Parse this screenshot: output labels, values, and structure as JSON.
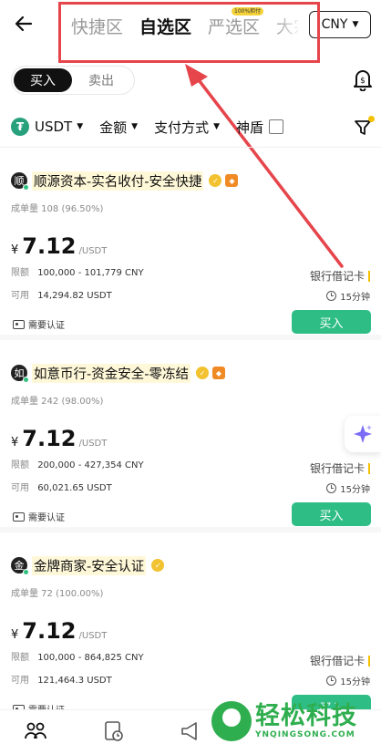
{
  "header": {
    "tabs": [
      {
        "label": "快捷区",
        "active": false
      },
      {
        "label": "自选区",
        "active": true
      },
      {
        "label": "严选区",
        "active": false,
        "badge": "100%担付"
      },
      {
        "label": "大宗",
        "active": false
      }
    ],
    "currency": "CNY"
  },
  "trade_toggle": {
    "buy": "买入",
    "sell": "卖出",
    "selected": "buy"
  },
  "filters": {
    "coin": "USDT",
    "amount": "金额",
    "payment": "支付方式",
    "shield": "神盾"
  },
  "merchants": [
    {
      "avatar": "顺",
      "name": "顺源资本-实名收付-安全快捷",
      "trades": "成单量 108 (96.50%)",
      "currency_symbol": "¥",
      "price": "7.12",
      "unit": "/USDT",
      "limit_label": "限额",
      "limit": "100,000 - 101,779 CNY",
      "available_label": "可用",
      "available": "14,294.82 USDT",
      "payment": "银行借记卡",
      "time": "15分钟",
      "verify": "需要认证",
      "action": "买入"
    },
    {
      "avatar": "如",
      "name": "如意币行-资金安全-零冻结",
      "trades": "成单量 242 (98.00%)",
      "currency_symbol": "¥",
      "price": "7.12",
      "unit": "/USDT",
      "limit_label": "限额",
      "limit": "200,000 - 427,354 CNY",
      "available_label": "可用",
      "available": "60,021.65 USDT",
      "payment": "银行借记卡",
      "time": "15分钟",
      "verify": "需要认证",
      "action": "买入"
    },
    {
      "avatar": "金",
      "name": "金牌商家-安全认证",
      "trades": "成单量 72 (100.00%)",
      "currency_symbol": "¥",
      "price": "7.12",
      "unit": "/USDT",
      "limit_label": "限额",
      "limit": "100,000 - 864,825 CNY",
      "available_label": "可用",
      "available": "121,464.3 USDT",
      "payment": "银行借记卡",
      "time": "15分钟",
      "verify": "需要认证",
      "action": "买入"
    }
  ],
  "watermark": {
    "cn": "轻松科技",
    "en": "YNQINGSONG.COM"
  },
  "colors": {
    "buy_green": "#2ebd85",
    "annotation_red": "#e5454b",
    "usdt_green": "#26a17b",
    "accent_yellow": "#f5c000"
  }
}
